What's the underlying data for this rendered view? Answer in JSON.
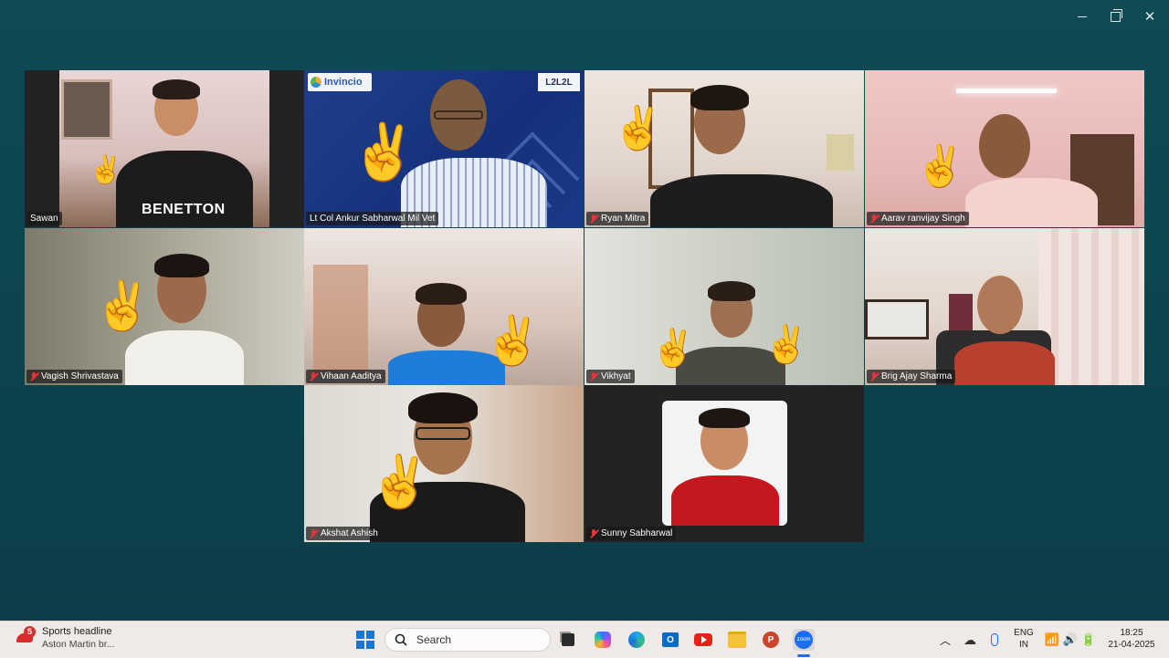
{
  "window_controls": {
    "minimize": "—",
    "maximize": "❐",
    "close": "✕"
  },
  "tiles": [
    {
      "name": "Sawan",
      "muted": false
    },
    {
      "name": "Lt Col Ankur Sabharwal Mil Vet",
      "muted": false,
      "active": true,
      "logo_text": "Invincio",
      "logo_text2": "L2L2L"
    },
    {
      "name": "Ryan Mitra",
      "muted": true
    },
    {
      "name": "Aarav ranvijay Singh",
      "muted": true
    },
    {
      "name": "Vagish Shrivastava",
      "muted": true
    },
    {
      "name": "Vihaan Aaditya",
      "muted": true
    },
    {
      "name": "Vikhyat",
      "muted": true
    },
    {
      "name": "Brig  Ajay Sharma",
      "muted": true
    },
    {
      "name": "Akshat Ashish",
      "muted": true
    },
    {
      "name": "Sunny Sabharwal",
      "muted": true
    }
  ],
  "shirt_text": "BENETTON",
  "taskbar": {
    "news_badge": "5",
    "news_title": "Sports headline",
    "news_sub": "Aston Martin br...",
    "search_placeholder": "Search",
    "lang_top": "ENG",
    "lang_bottom": "IN",
    "time": "18:25",
    "date": "21-04-2025",
    "zoom_label": "zoom"
  },
  "colors": {
    "active_border": "#2ecc71",
    "muted_mic": "#e0353b",
    "background": "#0d4550"
  }
}
